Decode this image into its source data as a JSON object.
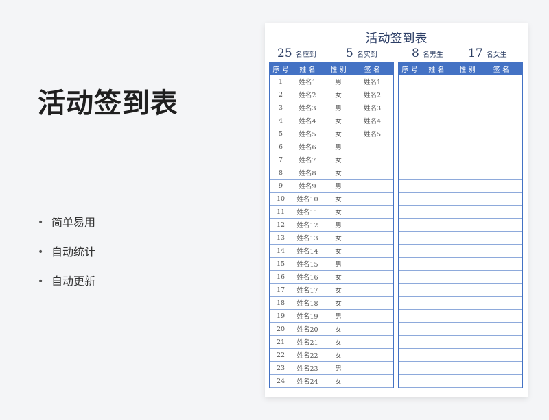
{
  "promo": {
    "title": "活动签到表",
    "features": [
      "简单易用",
      "自动统计",
      "自动更新"
    ],
    "bullet": "•"
  },
  "sheet": {
    "title": "活动签到表",
    "stats": [
      {
        "num": "25",
        "label": "名应到"
      },
      {
        "num": "5",
        "label": "名实到"
      },
      {
        "num": "8",
        "label": "名男生"
      },
      {
        "num": "17",
        "label": "名女生"
      }
    ],
    "headers": [
      "序 号",
      "姓 名",
      "性 别",
      "签 名"
    ],
    "rows": [
      [
        "1",
        "姓名1",
        "男",
        "姓名1"
      ],
      [
        "2",
        "姓名2",
        "女",
        "姓名2"
      ],
      [
        "3",
        "姓名3",
        "男",
        "姓名3"
      ],
      [
        "4",
        "姓名4",
        "女",
        "姓名4"
      ],
      [
        "5",
        "姓名5",
        "女",
        "姓名5"
      ],
      [
        "6",
        "姓名6",
        "男",
        ""
      ],
      [
        "7",
        "姓名7",
        "女",
        ""
      ],
      [
        "8",
        "姓名8",
        "女",
        ""
      ],
      [
        "9",
        "姓名9",
        "男",
        ""
      ],
      [
        "10",
        "姓名10",
        "女",
        ""
      ],
      [
        "11",
        "姓名11",
        "女",
        ""
      ],
      [
        "12",
        "姓名12",
        "男",
        ""
      ],
      [
        "13",
        "姓名13",
        "女",
        ""
      ],
      [
        "14",
        "姓名14",
        "女",
        ""
      ],
      [
        "15",
        "姓名15",
        "男",
        ""
      ],
      [
        "16",
        "姓名16",
        "女",
        ""
      ],
      [
        "17",
        "姓名17",
        "女",
        ""
      ],
      [
        "18",
        "姓名18",
        "女",
        ""
      ],
      [
        "19",
        "姓名19",
        "男",
        ""
      ],
      [
        "20",
        "姓名20",
        "女",
        ""
      ],
      [
        "21",
        "姓名21",
        "女",
        ""
      ],
      [
        "22",
        "姓名22",
        "女",
        ""
      ],
      [
        "23",
        "姓名23",
        "男",
        ""
      ],
      [
        "24",
        "姓名24",
        "女",
        ""
      ]
    ],
    "colors": {
      "header_bg": "#4472c4",
      "grid": "#8eaadb",
      "title": "#2c3e66"
    }
  }
}
